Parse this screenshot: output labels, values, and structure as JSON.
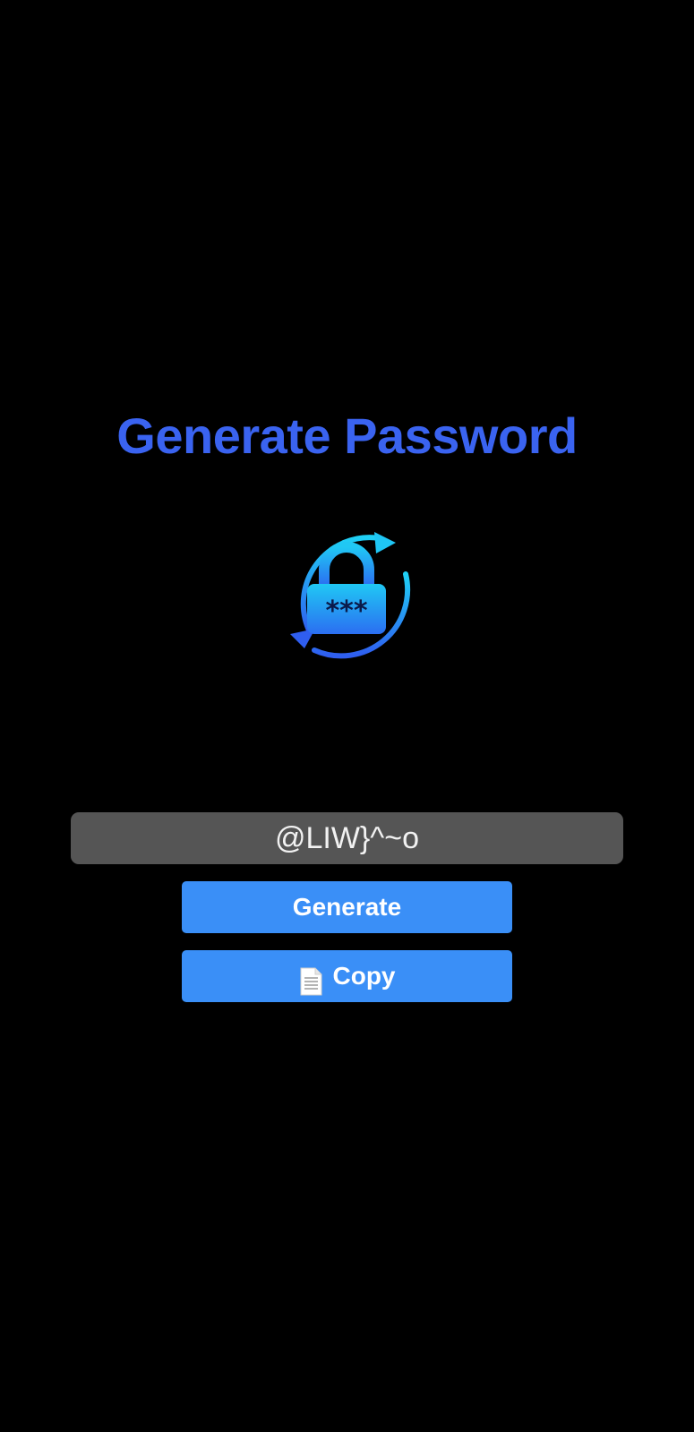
{
  "page": {
    "background": "#000000",
    "accent_color": "#3a63f0",
    "button_color": "#3a8ff7",
    "field_color": "#555555"
  },
  "header": {
    "title": "Generate Password"
  },
  "logo": {
    "icon": "lock-refresh-icon"
  },
  "password": {
    "value": "@LIW}^~o"
  },
  "actions": {
    "generate_label": "Generate",
    "copy_label": "Copy",
    "copy_icon": "document-icon"
  }
}
